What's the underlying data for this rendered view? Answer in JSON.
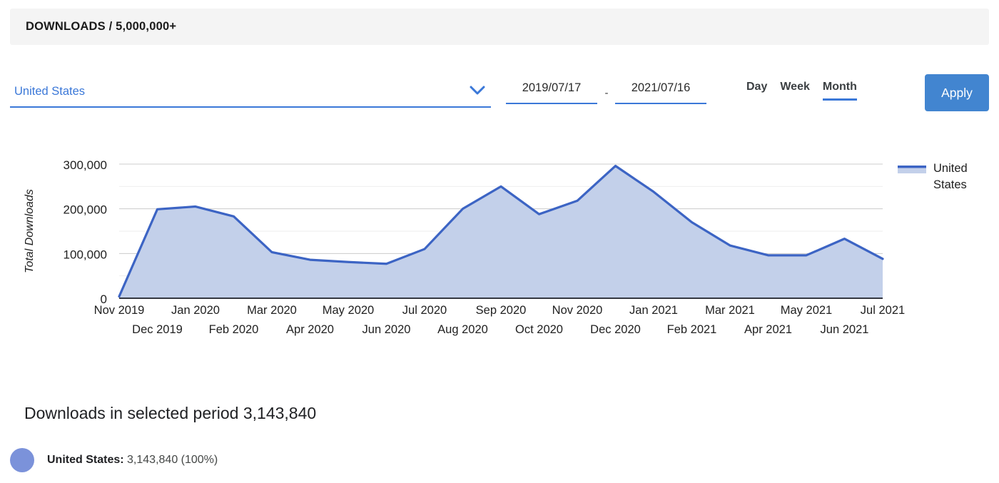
{
  "header": {
    "title": "DOWNLOADS / 5,000,000+"
  },
  "controls": {
    "country_select": {
      "value": "United States",
      "icon": "chevron-down-icon"
    },
    "date_start": "2019/07/17",
    "date_separator": "-",
    "date_end": "2021/07/16",
    "granularity": [
      {
        "label": "Day",
        "selected": false
      },
      {
        "label": "Week",
        "selected": false
      },
      {
        "label": "Month",
        "selected": true
      }
    ],
    "apply_label": "Apply"
  },
  "chart_data": {
    "type": "area",
    "title": "",
    "xlabel": "",
    "ylabel": "Total Downloads",
    "ylim": [
      0,
      300000
    ],
    "yticks": [
      0,
      100000,
      200000,
      300000
    ],
    "ytick_labels": [
      "0",
      "100,000",
      "200,000",
      "300,000"
    ],
    "minor_gridlines": [
      50000,
      150000,
      250000
    ],
    "grid": true,
    "legend_position": "right",
    "categories": [
      "Nov 2019",
      "Dec 2019",
      "Jan 2020",
      "Feb 2020",
      "Mar 2020",
      "Apr 2020",
      "May 2020",
      "Jun 2020",
      "Jul 2020",
      "Aug 2020",
      "Sep 2020",
      "Oct 2020",
      "Nov 2020",
      "Dec 2020",
      "Jan 2021",
      "Feb 2021",
      "Mar 2021",
      "Apr 2021",
      "May 2021",
      "Jun 2021",
      "Jul 2021"
    ],
    "series": [
      {
        "name": "United States",
        "color": "#3c64c4",
        "fill": "#c3d0ea",
        "values": [
          4000,
          199000,
          205000,
          183000,
          103000,
          86000,
          81000,
          77000,
          110000,
          200000,
          250000,
          188000,
          218000,
          296000,
          238000,
          170000,
          118000,
          96000,
          96000,
          133000,
          88000
        ]
      }
    ],
    "legend": [
      {
        "label_line1": "United",
        "label_line2": "States",
        "color": "#3c64c4",
        "fill": "#c3d0ea"
      }
    ]
  },
  "summary": {
    "title": "Downloads in selected period 3,143,840",
    "entries": [
      {
        "dot_color": "#7b92da",
        "label": "United States:",
        "value": "3,143,840 (100%)"
      }
    ]
  }
}
